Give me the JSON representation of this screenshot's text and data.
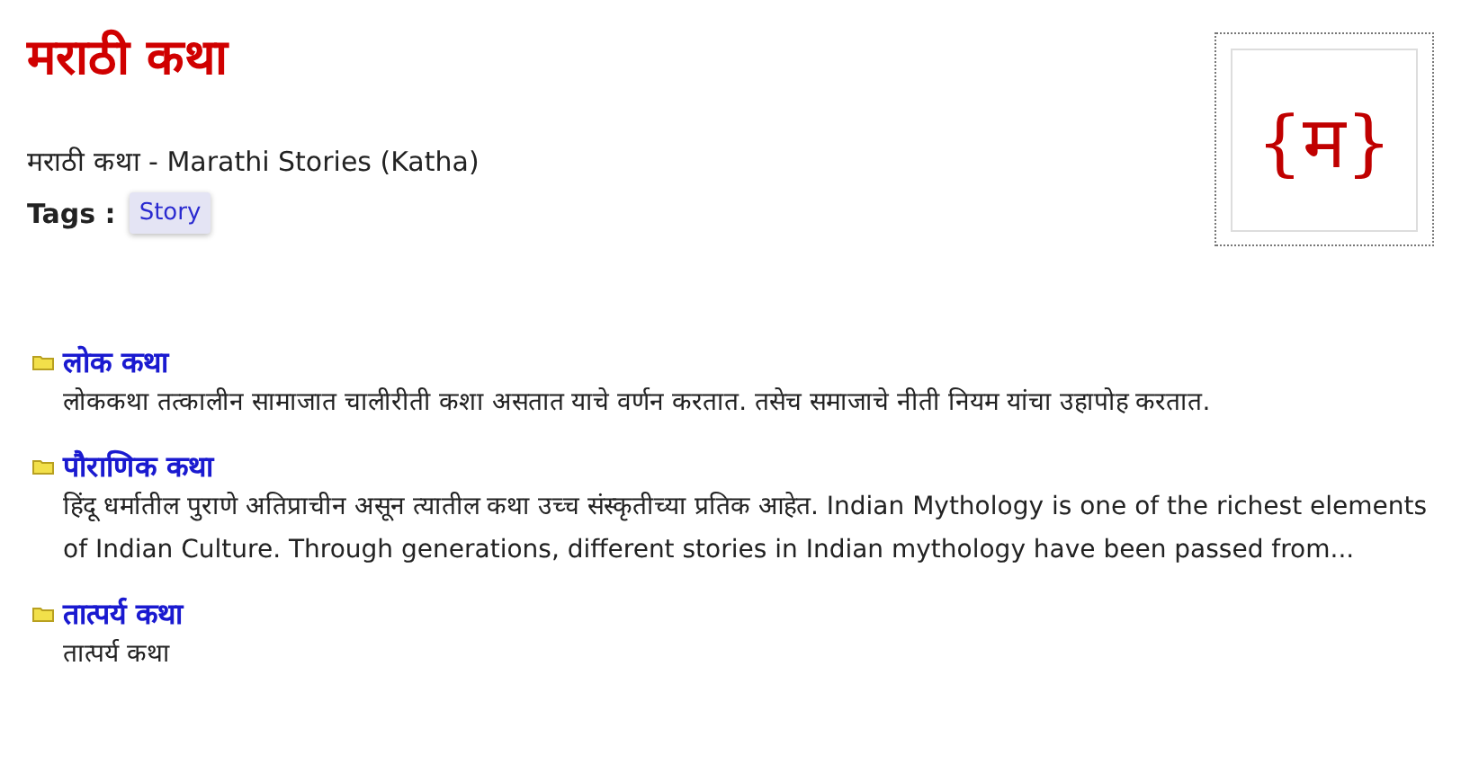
{
  "page": {
    "title": "मराठी कथा",
    "subtitle": "मराठी कथा - Marathi Stories (Katha)",
    "tags_label": "Tags :",
    "tags": [
      "Story"
    ],
    "logo": "{म}"
  },
  "categories": [
    {
      "title": "लोक कथा",
      "description": "लोककथा तत्कालीन सामाजात चालीरीती कशा असतात याचे वर्णन करतात. तसेच समाजाचे नीती नियम यांचा उहापोह करतात."
    },
    {
      "title": "पौराणिक कथा",
      "description": "हिंदू धर्मातील पुराणे अतिप्राचीन असून त्यातील कथा उच्च संस्कृतीच्या प्रतिक आहेत. Indian Mythology is one of the richest elements of Indian Culture. Through generations, different stories in Indian mythology have been passed from..."
    },
    {
      "title": "तात्पर्य कथा",
      "description": "तात्पर्य कथा"
    }
  ]
}
